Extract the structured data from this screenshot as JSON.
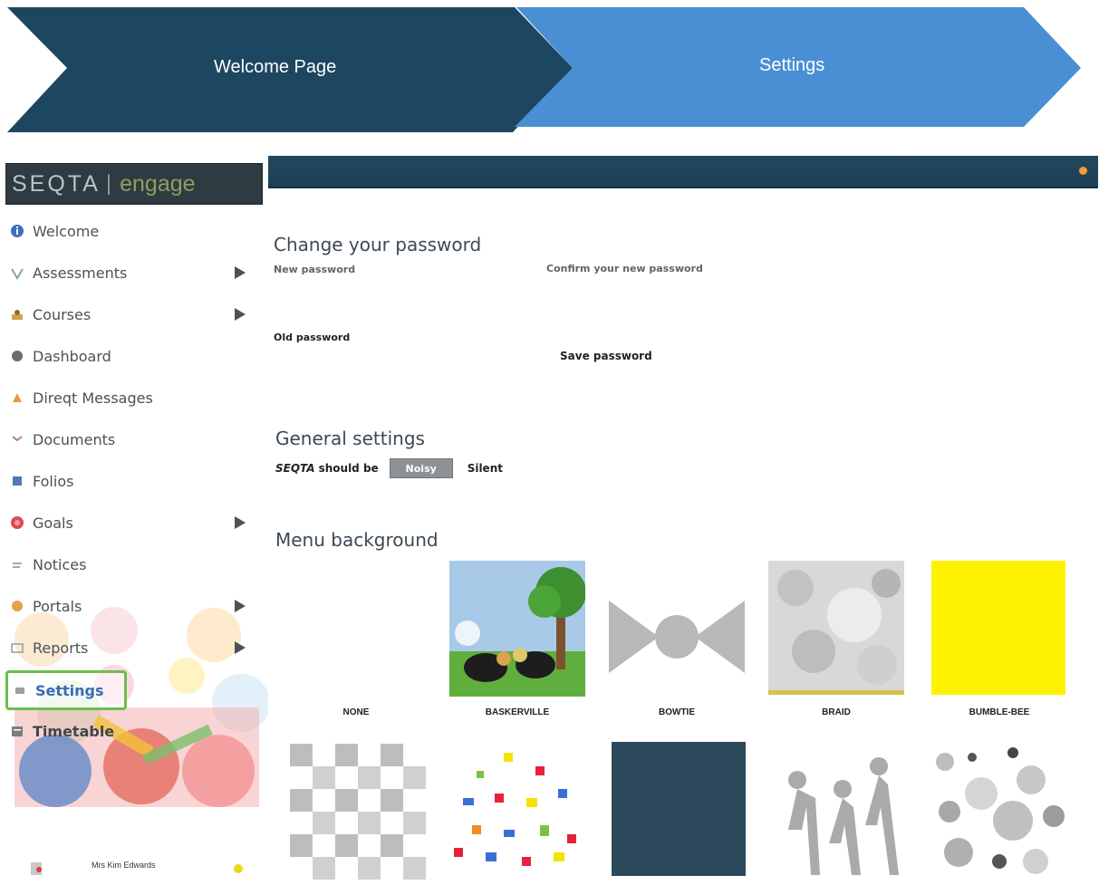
{
  "banner": {
    "step1": "Welcome Page",
    "step2": "Settings",
    "step1_color": "#1d4661",
    "step2_color": "#4a8fd4"
  },
  "app": {
    "logo_primary": "SEQTA",
    "logo_separator": "|",
    "logo_secondary": "engage",
    "header_color": "#23475e",
    "accent_color": "#f39c33"
  },
  "sidebar": {
    "items": [
      {
        "label": "Welcome",
        "icon": "info-icon",
        "has_submenu": false
      },
      {
        "label": "Assessments",
        "icon": "assessments-icon",
        "has_submenu": true
      },
      {
        "label": "Courses",
        "icon": "courses-icon",
        "has_submenu": true
      },
      {
        "label": "Dashboard",
        "icon": "dashboard-icon",
        "has_submenu": false
      },
      {
        "label": "Direqt Messages",
        "icon": "messages-icon",
        "has_submenu": false
      },
      {
        "label": "Documents",
        "icon": "documents-icon",
        "has_submenu": false
      },
      {
        "label": "Folios",
        "icon": "folios-icon",
        "has_submenu": false
      },
      {
        "label": "Goals",
        "icon": "goals-icon",
        "has_submenu": true
      },
      {
        "label": "Notices",
        "icon": "notices-icon",
        "has_submenu": false
      },
      {
        "label": "Portals",
        "icon": "portals-icon",
        "has_submenu": true
      },
      {
        "label": "Reports",
        "icon": "reports-icon",
        "has_submenu": true
      },
      {
        "label": "Settings",
        "icon": "settings-icon",
        "has_submenu": false,
        "active": true
      },
      {
        "label": "Timetable",
        "icon": "timetable-icon",
        "has_submenu": false
      }
    ],
    "user_name": "Mrs Kim Edwards"
  },
  "password": {
    "title": "Change your password",
    "new_label": "New password",
    "confirm_label": "Confirm your new password",
    "old_label": "Old password",
    "save_label": "Save password"
  },
  "general": {
    "title": "General settings",
    "prefix": "SEQTA",
    "prefix_suffix": "should be",
    "toggle_value": "Noisy",
    "alt_option": "Silent"
  },
  "menu_background": {
    "title": "Menu background",
    "options": [
      {
        "label": "NONE"
      },
      {
        "label": "BASKERVILLE"
      },
      {
        "label": "BOWTIE"
      },
      {
        "label": "BRAID"
      },
      {
        "label": "BUMBLE-BEE"
      },
      {
        "label": ""
      },
      {
        "label": ""
      },
      {
        "label": ""
      },
      {
        "label": ""
      },
      {
        "label": ""
      }
    ]
  }
}
